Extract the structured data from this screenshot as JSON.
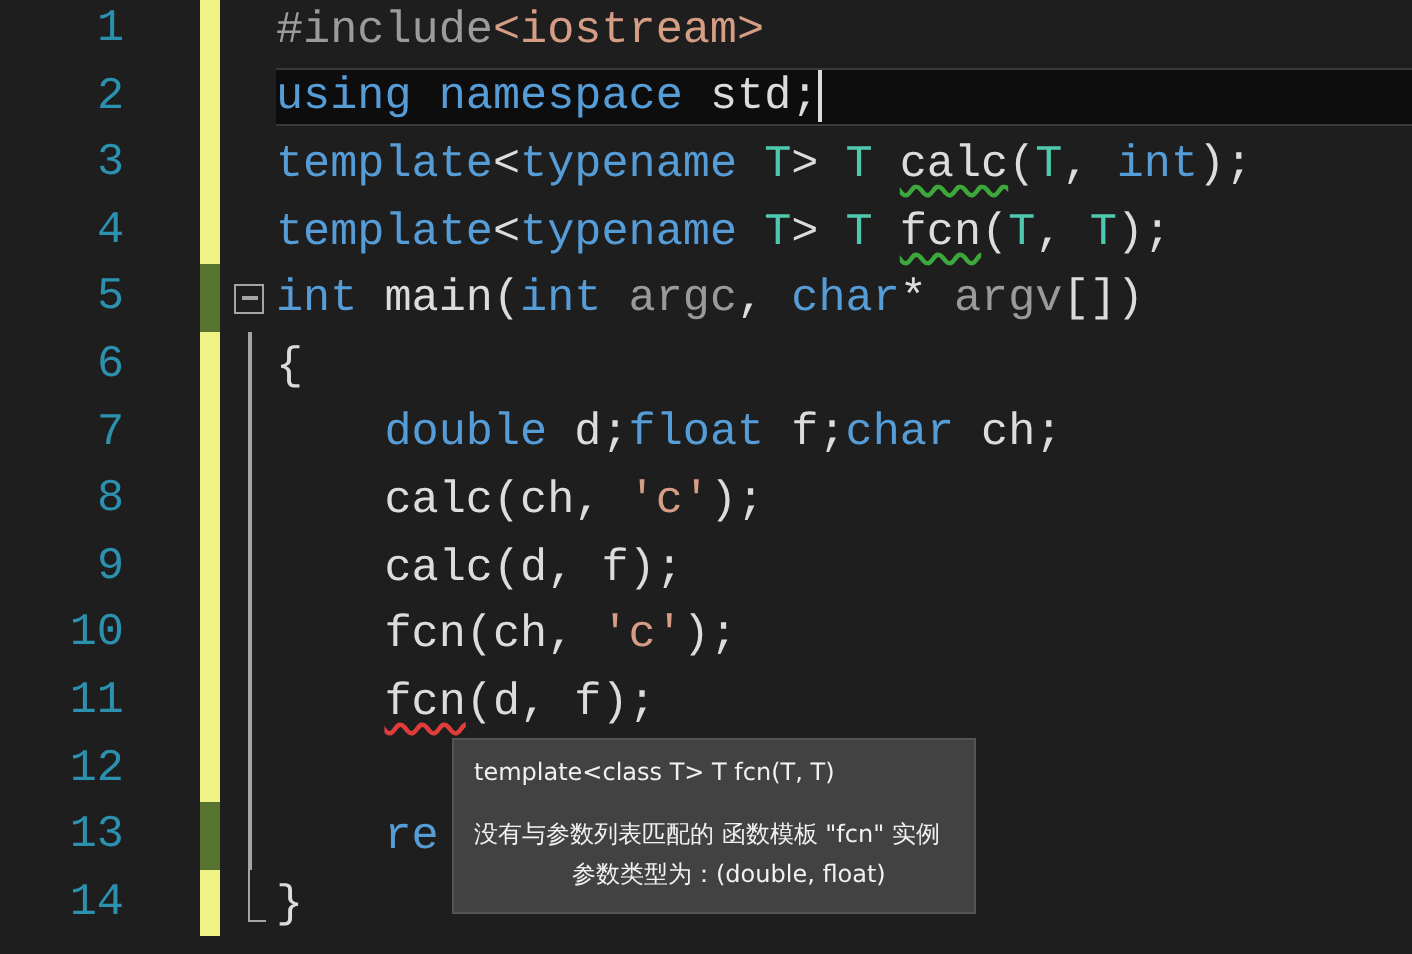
{
  "editor": {
    "lines": [
      {
        "number": "1",
        "saved": false,
        "tokens": [
          {
            "text": "#include",
            "kind": "preprocessor"
          },
          {
            "text": "<iostream>",
            "kind": "string"
          }
        ]
      },
      {
        "number": "2",
        "saved": false,
        "current": true,
        "tokens": [
          {
            "text": "using ",
            "kind": "keyword"
          },
          {
            "text": "namespace",
            "kind": "keyword"
          },
          {
            "text": " std;",
            "kind": "plain"
          }
        ]
      },
      {
        "number": "3",
        "saved": false,
        "tokens": [
          {
            "text": "template",
            "kind": "keyword"
          },
          {
            "text": "<",
            "kind": "plain"
          },
          {
            "text": "typename ",
            "kind": "keyword"
          },
          {
            "text": "T",
            "kind": "type"
          },
          {
            "text": "> ",
            "kind": "plain"
          },
          {
            "text": "T ",
            "kind": "type"
          },
          {
            "text": "calc",
            "kind": "plain",
            "warning": true
          },
          {
            "text": "(",
            "kind": "plain"
          },
          {
            "text": "T",
            "kind": "type"
          },
          {
            "text": ", ",
            "kind": "plain"
          },
          {
            "text": "int",
            "kind": "keyword"
          },
          {
            "text": ");",
            "kind": "plain"
          }
        ]
      },
      {
        "number": "4",
        "saved": false,
        "tokens": [
          {
            "text": "template",
            "kind": "keyword"
          },
          {
            "text": "<",
            "kind": "plain"
          },
          {
            "text": "typename ",
            "kind": "keyword"
          },
          {
            "text": "T",
            "kind": "type"
          },
          {
            "text": "> ",
            "kind": "plain"
          },
          {
            "text": "T ",
            "kind": "type"
          },
          {
            "text": "fcn",
            "kind": "plain",
            "warning": true
          },
          {
            "text": "(",
            "kind": "plain"
          },
          {
            "text": "T",
            "kind": "type"
          },
          {
            "text": ", ",
            "kind": "plain"
          },
          {
            "text": "T",
            "kind": "type"
          },
          {
            "text": ");",
            "kind": "plain"
          }
        ]
      },
      {
        "number": "5",
        "saved": true,
        "expanded": true,
        "tokens": [
          {
            "text": "int",
            "kind": "keyword"
          },
          {
            "text": " main(",
            "kind": "plain"
          },
          {
            "text": "int ",
            "kind": "keyword"
          },
          {
            "text": "argc",
            "kind": "parameter"
          },
          {
            "text": ", ",
            "kind": "plain"
          },
          {
            "text": "char",
            "kind": "keyword"
          },
          {
            "text": "* ",
            "kind": "plain"
          },
          {
            "text": "argv",
            "kind": "parameter"
          },
          {
            "text": "[])",
            "kind": "plain"
          }
        ],
        "children": [
          {
            "number": "6",
            "saved": false,
            "tokens": [
              {
                "text": "{",
                "kind": "plain"
              }
            ]
          },
          {
            "number": "7",
            "saved": false,
            "tokens": [
              {
                "text": "    double",
                "kind": "keyword"
              },
              {
                "text": " d;",
                "kind": "plain"
              },
              {
                "text": "float",
                "kind": "keyword"
              },
              {
                "text": " f;",
                "kind": "plain"
              },
              {
                "text": "char",
                "kind": "keyword"
              },
              {
                "text": " ch;",
                "kind": "plain"
              }
            ]
          },
          {
            "number": "8",
            "saved": false,
            "tokens": [
              {
                "text": "    calc(ch, ",
                "kind": "plain"
              },
              {
                "text": "'c'",
                "kind": "string"
              },
              {
                "text": ");",
                "kind": "plain"
              }
            ]
          },
          {
            "number": "9",
            "saved": false,
            "tokens": [
              {
                "text": "    calc(d, f);",
                "kind": "plain"
              }
            ]
          },
          {
            "number": "10",
            "saved": false,
            "tokens": [
              {
                "text": "    fcn(ch, ",
                "kind": "plain"
              },
              {
                "text": "'c'",
                "kind": "string"
              },
              {
                "text": ");",
                "kind": "plain"
              }
            ]
          },
          {
            "number": "11",
            "saved": false,
            "tokens": [
              {
                "text": "    fcn",
                "kind": "plain",
                "error": true
              },
              {
                "text": "(d, f);",
                "kind": "plain"
              }
            ]
          },
          {
            "number": "12",
            "saved": false
          },
          {
            "number": "13",
            "saved": true,
            "tokens": [
              {
                "text": "    re",
                "kind": "keyword"
              }
            ]
          },
          {
            "number": "14",
            "saved": false,
            "tokens": [
              {
                "text": "}",
                "kind": "plain"
              }
            ]
          }
        ]
      }
    ]
  },
  "tooltip": {
    "signature": "template<class T> T fcn(T, T)",
    "message": "没有与参数列表匹配的 函数模板 \"fcn\" 实例",
    "detail": "参数类型为：(double, float)"
  }
}
